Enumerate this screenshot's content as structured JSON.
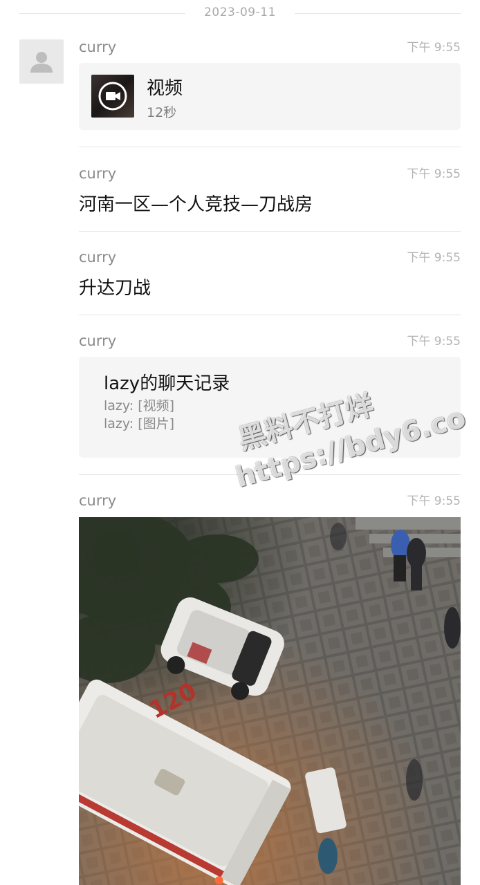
{
  "date_separator": "2023-09-11",
  "messages": [
    {
      "sender": "curry",
      "time": "下午 9:55",
      "type": "video",
      "video": {
        "title": "视频",
        "duration": "12秒"
      }
    },
    {
      "sender": "curry",
      "time": "下午 9:55",
      "type": "text",
      "text": "河南一区—个人竞技—刀战房"
    },
    {
      "sender": "curry",
      "time": "下午 9:55",
      "type": "text",
      "text": "升达刀战"
    },
    {
      "sender": "curry",
      "time": "下午 9:55",
      "type": "chat_record",
      "record": {
        "title": "lazy的聊天记录",
        "lines": [
          "lazy: [视频]",
          "lazy: [图片]"
        ]
      }
    },
    {
      "sender": "curry",
      "time": "下午 9:55",
      "type": "image",
      "image": {
        "visible_text": "120"
      }
    }
  ],
  "watermark": {
    "line1": "黑料不打烊",
    "line2": "https://bdy6.co"
  },
  "icons": {
    "avatar": "default-avatar-icon",
    "video": "video-camera-icon"
  },
  "colors": {
    "card_bg": "#f5f5f5",
    "meta_text": "#8a8a8a",
    "time_text": "#b3b3b3"
  }
}
